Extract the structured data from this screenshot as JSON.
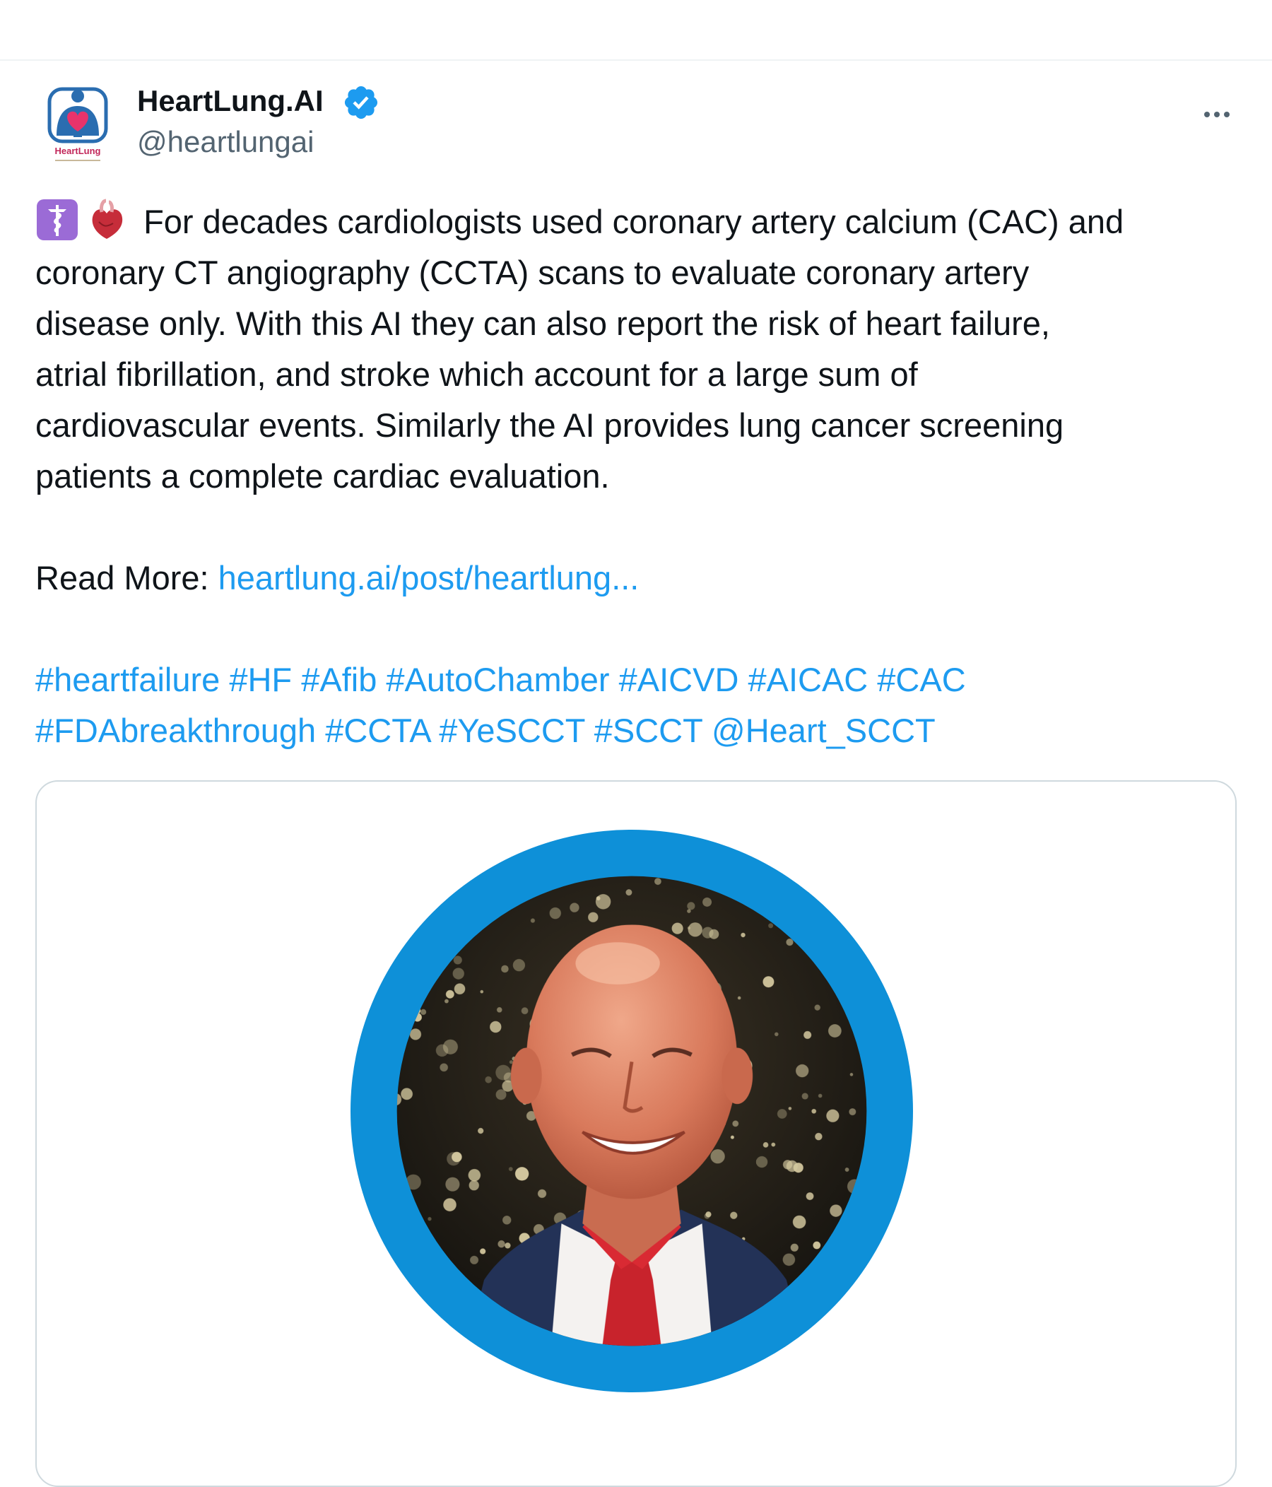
{
  "author": {
    "display_name": "HeartLung.AI",
    "handle": "@heartlungai",
    "verified": true,
    "avatar_icon": "heartlung-logo-icon",
    "avatar_text": "HeartLung"
  },
  "menu": {
    "icon": "more-horizontal-icon"
  },
  "post": {
    "emojis": [
      "medical-symbol-icon",
      "anatomical-heart-icon"
    ],
    "lines": [
      "For decades cardiologists used coronary artery calcium (CAC) and",
      "coronary CT angiography (CCTA) scans to evaluate coronary artery",
      "disease only. With this AI they can also report the risk of heart failure,",
      "atrial fibrillation, and stroke which account for a large sum of",
      "cardiovascular events. Similarly the AI provides lung cancer screening",
      "patients a complete cardiac evaluation."
    ],
    "read_more_label": "Read More:",
    "read_more_link": "heartlung.ai/post/heartlung...",
    "hashtags": [
      [
        "#heartfailure",
        "#HF",
        "#Afib",
        "#AutoChamber",
        "#AICVD",
        "#AICAC",
        "#CAC"
      ],
      [
        "#FDAbreakthrough",
        "#CCTA",
        "#YeSCCT",
        "#SCCT",
        "@Heart_SCCT"
      ]
    ]
  },
  "media": {
    "ring_color": "#0e90d8"
  }
}
